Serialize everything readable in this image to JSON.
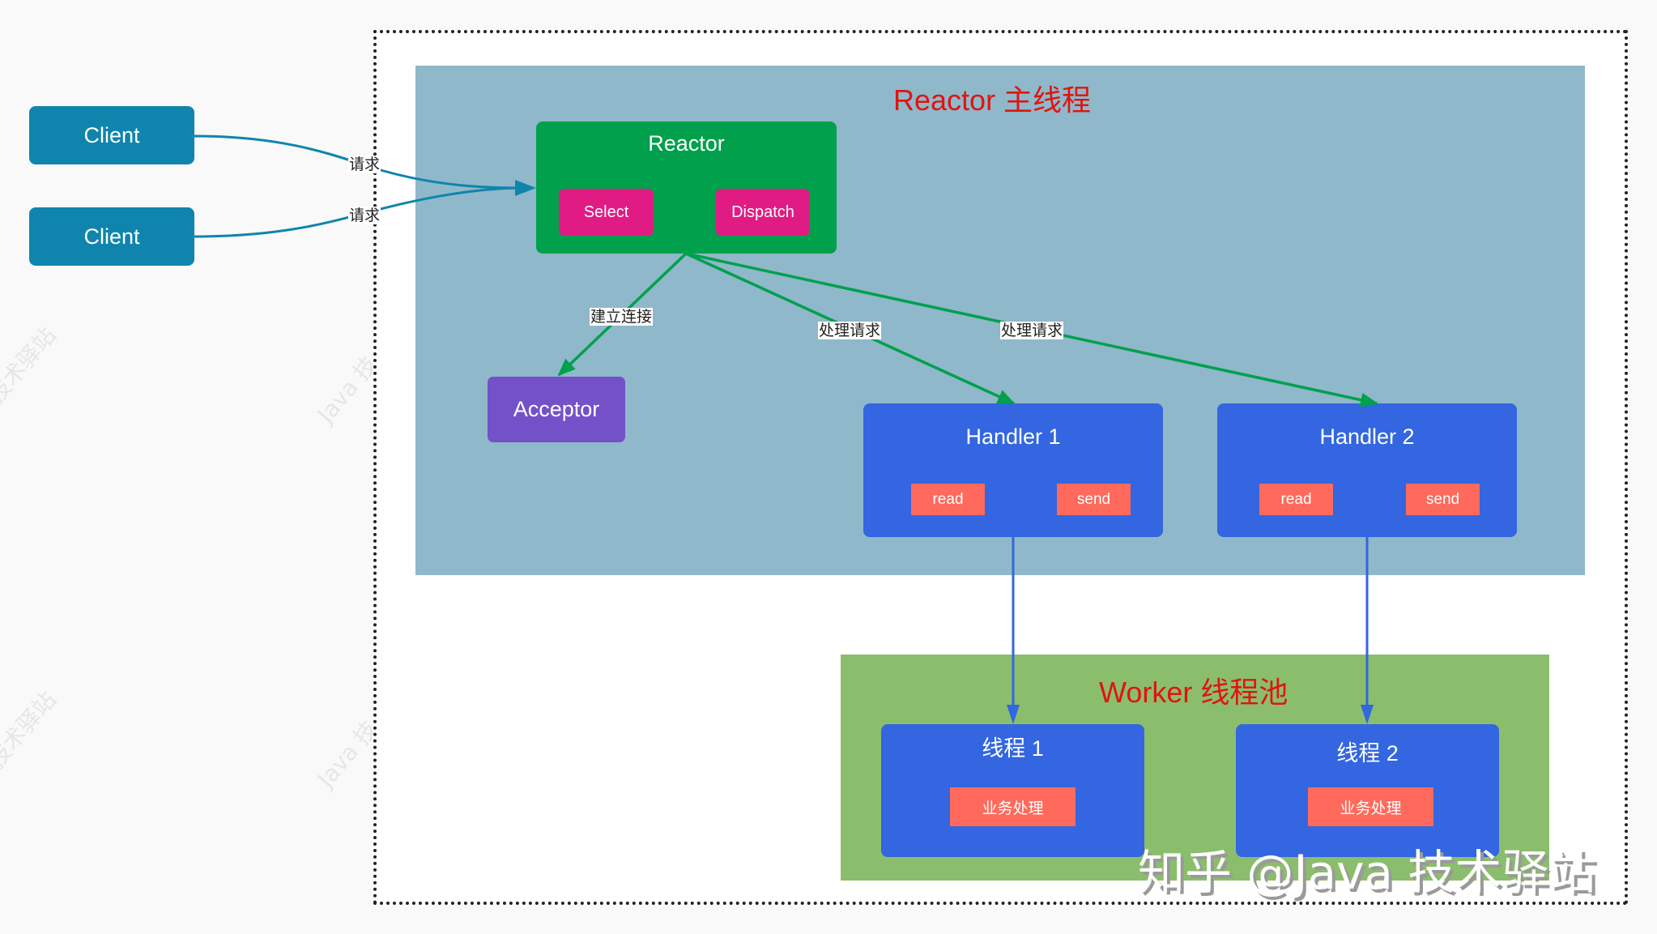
{
  "regions": {
    "reactor_main": {
      "title": "Reactor 主线程",
      "color": "#8fb8ca"
    },
    "worker_pool": {
      "title": "Worker 线程池",
      "color": "#8bbe6c"
    }
  },
  "clients": [
    {
      "label": "Client"
    },
    {
      "label": "Client"
    }
  ],
  "reactor": {
    "title": "Reactor",
    "components": [
      {
        "label": "Select"
      },
      {
        "label": "Dispatch"
      }
    ]
  },
  "acceptor": {
    "label": "Acceptor"
  },
  "handlers": [
    {
      "title": "Handler 1",
      "actions": [
        {
          "label": "read"
        },
        {
          "label": "send"
        }
      ]
    },
    {
      "title": "Handler 2",
      "actions": [
        {
          "label": "read"
        },
        {
          "label": "send"
        }
      ]
    }
  ],
  "threads": [
    {
      "title": "线程 1",
      "task": "业务处理"
    },
    {
      "title": "线程 2",
      "task": "业务处理"
    }
  ],
  "edges": {
    "client_requests": [
      {
        "label": "请求"
      },
      {
        "label": "请求"
      }
    ],
    "connect": {
      "label": "建立连接"
    },
    "handle_requests": [
      {
        "label": "处理请求"
      },
      {
        "label": "处理请求"
      }
    ]
  },
  "watermarks": {
    "corner": "知乎 @Java 技术驿站",
    "faint": [
      "技术驿站",
      "Java 技",
      "技术驿站",
      "Java 技"
    ]
  },
  "colors": {
    "client": "#0f85ad",
    "reactor": "#00a04c",
    "reactor_parts": "#e01b84",
    "acceptor": "#7451c9",
    "handler": "#3366e0",
    "action": "#ff6a5c",
    "region_title": "#e0140f",
    "request_edge": "#0f85ad",
    "dispatch_edge": "#00a04c",
    "worker_edge": "#3366e0"
  }
}
